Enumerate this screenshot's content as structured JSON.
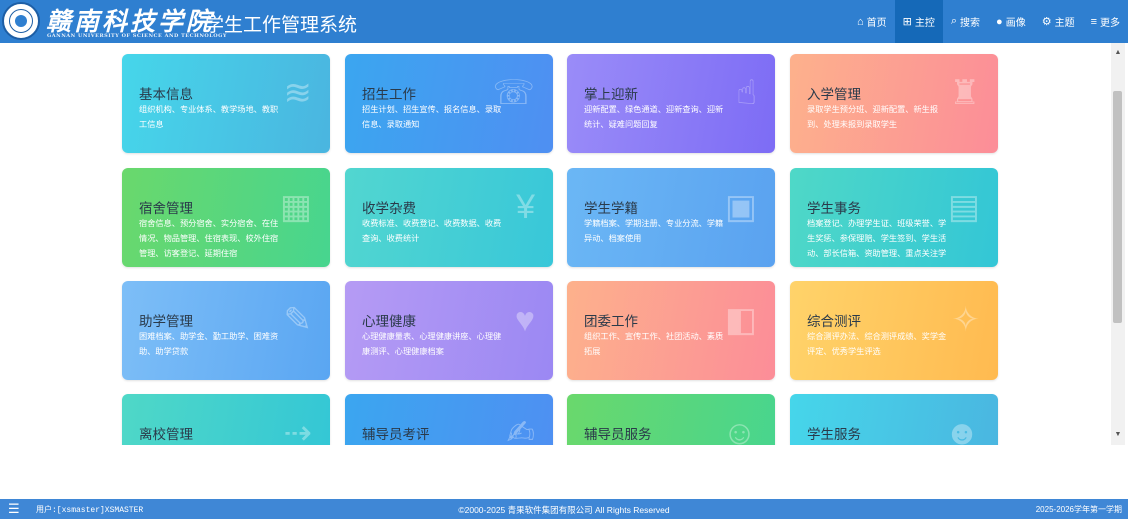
{
  "header": {
    "school_name": "赣南科技学院",
    "school_en": "GANNAN UNIVERSITY OF SCIENCE AND TECHNOLOGY",
    "system_title": "学生工作管理系统",
    "nav": [
      {
        "icon": "⌂",
        "label": "首页"
      },
      {
        "icon": "⊞",
        "label": "主控"
      },
      {
        "icon": "⌕",
        "label": "搜索"
      },
      {
        "icon": "●",
        "label": "画像"
      },
      {
        "icon": "⚙",
        "label": "主题"
      },
      {
        "icon": "≡",
        "label": "更多"
      }
    ]
  },
  "tiles": [
    {
      "title": "基本信息",
      "desc": "组织机构、专业体系、教学场地、教职工信息",
      "icon": "≋",
      "icon_name": "layers-icon"
    },
    {
      "title": "招生工作",
      "desc": "招生计划、招生宣传、报名信息、录取信息、录取通知",
      "icon": "☏",
      "icon_name": "contact-book-icon"
    },
    {
      "title": "掌上迎新",
      "desc": "迎新配置、绿色通道、迎新查询、迎新统计、疑难问题回复",
      "icon": "☝",
      "icon_name": "hand-phone-icon"
    },
    {
      "title": "入学管理",
      "desc": "录取学生预分班、迎新配置、新生报到、处理未报到录取学生",
      "icon": "♜",
      "icon_name": "blocks-icon"
    },
    {
      "title": "宿舍管理",
      "desc": "宿舍信息、预分宿舍、实分宿舍、在住情况、物品管理、住宿表现、校外住宿管理、访客登记、延期住宿",
      "icon": "▦",
      "icon_name": "building-icon"
    },
    {
      "title": "收学杂费",
      "desc": "收费标准、收费登记、收费数据、收费查询、收费统计",
      "icon": "¥",
      "icon_name": "wallet-icon"
    },
    {
      "title": "学生学籍",
      "desc": "学籍档案、学期注册、专业分流、学籍异动、档案使用",
      "icon": "▣",
      "icon_name": "id-card-icon"
    },
    {
      "title": "学生事务",
      "desc": "档案登记、办理学生证、班级荣誉、学生奖惩、参保理赔、学生签到、学生活动、部长信箱、资助管理、重点关注学生",
      "icon": "▤",
      "icon_name": "briefcase-icon"
    },
    {
      "title": "助学管理",
      "desc": "困难档案、助学金、勤工助学、困难资助、助学贷款",
      "icon": "✎",
      "icon_name": "clipboard-icon"
    },
    {
      "title": "心理健康",
      "desc": "心理健康量表、心理健康讲座、心理健康测评、心理健康档案",
      "icon": "♥",
      "icon_name": "heartbeat-icon"
    },
    {
      "title": "团委工作",
      "desc": "组织工作、宣传工作、社团活动、素质拓展",
      "icon": "◧",
      "icon_name": "party-flag-icon"
    },
    {
      "title": "综合测评",
      "desc": "综合测评办法、综合测评成绩、奖学金评定、优秀学生评选",
      "icon": "✧",
      "icon_name": "network-icon"
    },
    {
      "title": "离校管理",
      "desc": "",
      "icon": "⇢",
      "icon_name": "leave-icon"
    },
    {
      "title": "辅导员考评",
      "desc": "",
      "icon": "✍",
      "icon_name": "evaluation-icon"
    },
    {
      "title": "辅导员服务",
      "desc": "",
      "icon": "☺",
      "icon_name": "counselor-icon"
    },
    {
      "title": "学生服务",
      "desc": "",
      "icon": "☻",
      "icon_name": "graduate-icon"
    }
  ],
  "footer": {
    "user": "用户:[xsmaster]XSMASTER",
    "copyright": "©2000-2025 青果软件集团有限公司 All Rights Reserved",
    "term": "2025-2026学年第一学期"
  },
  "colors": {
    "header_bg": "#2f7fd0",
    "nav_active_bg": "#1569b8",
    "footer_bg": "#3f87d6"
  }
}
